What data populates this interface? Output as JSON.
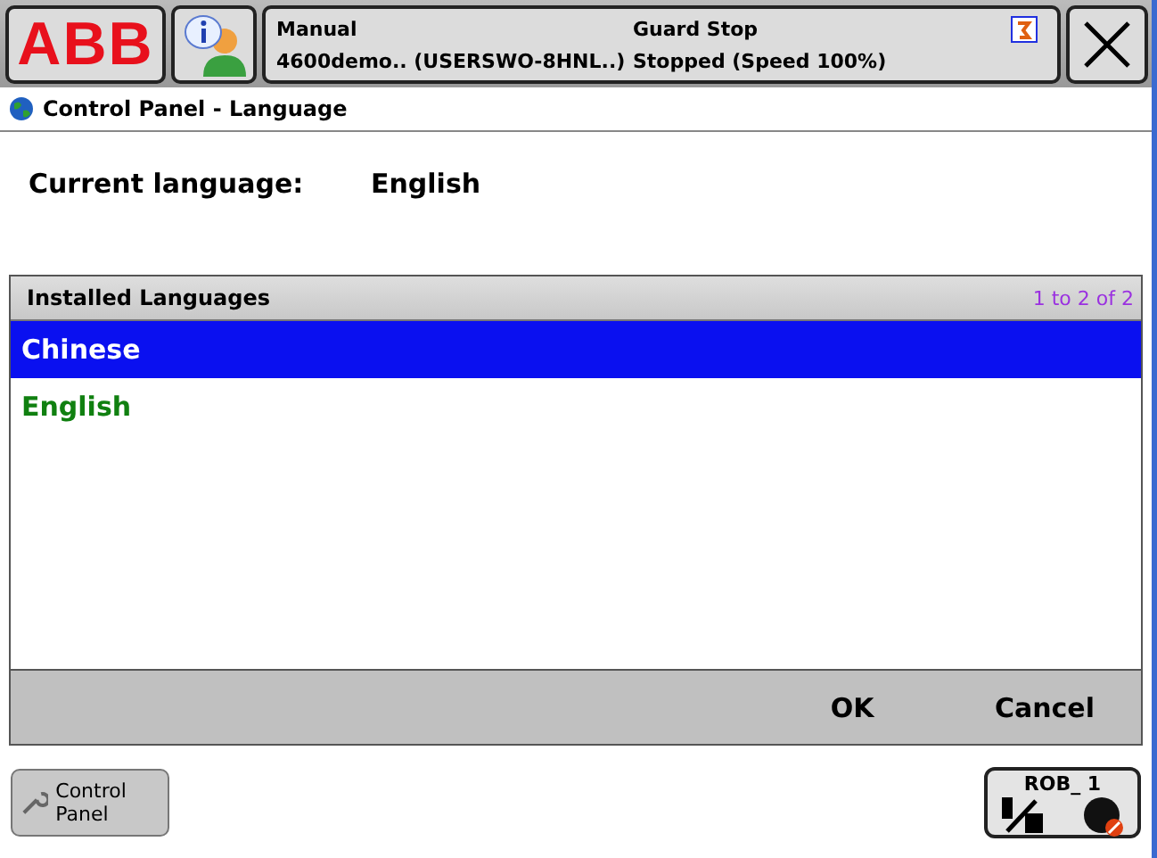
{
  "top_bar": {
    "logo": "ABB",
    "mode": "Manual",
    "system": "4600demo.. (USERSWO-8HNL..)",
    "state": "Guard Stop",
    "speed": "Stopped (Speed 100%)"
  },
  "title": "Control Panel - Language",
  "current_language": {
    "label": "Current language:",
    "value": "English"
  },
  "list": {
    "header": "Installed Languages",
    "count": "1 to 2 of 2",
    "items": [
      {
        "label": "Chinese",
        "selected": true
      },
      {
        "label": "English",
        "selected": false
      }
    ]
  },
  "buttons": [
    "OK",
    "Cancel"
  ],
  "taskbar": {
    "item": "Control Panel",
    "robot": "ROB_ 1"
  }
}
